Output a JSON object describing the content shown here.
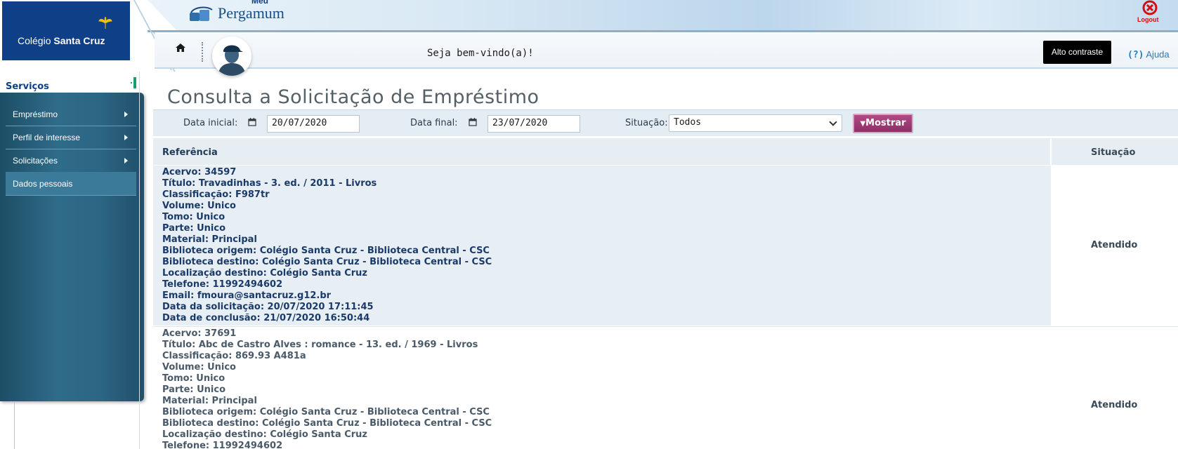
{
  "header": {
    "school_name_light": "Colégio ",
    "school_name_bold": "Santa Cruz",
    "brand_top": "Meu",
    "brand_name": "Pergamum",
    "logout_label": "Logout",
    "welcome": "Seja bem-vindo(a)!",
    "contrast_label": "Alto contraste",
    "help_prefix": "(?)",
    "help_label": " Ajuda"
  },
  "sidebar": {
    "title": "Serviços",
    "items": [
      {
        "label": "Empréstimo",
        "has_submenu": true
      },
      {
        "label": "Perfil de interesse",
        "has_submenu": true
      },
      {
        "label": "Solicitações",
        "has_submenu": true
      },
      {
        "label": "Dados pessoais",
        "has_submenu": false
      }
    ]
  },
  "main": {
    "title": "Consulta a Solicitação de Empréstimo",
    "filters": {
      "start_label": "Data inicial:",
      "start_value": "20/07/2020",
      "end_label": "Data final:",
      "end_value": "23/07/2020",
      "status_label": "Situação:",
      "status_value": "Todos",
      "submit_label": "Mostrar"
    },
    "table": {
      "col_reference": "Referência",
      "col_status": "Situação",
      "rows": [
        {
          "lines": [
            "Acervo: 34597",
            "Título: Travadinhas - 3. ed. / 2011 - Livros",
            "Classificação: F987tr",
            "Volume: Unico",
            "Tomo: Unico",
            "Parte: Unico",
            "Material: Principal",
            "Biblioteca origem: Colégio Santa Cruz - Biblioteca Central - CSC",
            "Biblioteca destino: Colégio Santa Cruz - Biblioteca Central - CSC",
            "Localização destino: Colégio Santa Cruz",
            "Telefone: 11992494602",
            "Email: fmoura@santacruz.g12.br",
            "Data da solicitação: 20/07/2020 17:11:45",
            "Data de conclusão: 21/07/2020 16:50:44"
          ],
          "status": "Atendido"
        },
        {
          "lines": [
            "Acervo: 37691",
            "Título: Abc de Castro Alves : romance - 13. ed. / 1969 - Livros",
            "Classificação: 869.93 A481a",
            "Volume: Unico",
            "Tomo: Unico",
            "Parte: Unico",
            "Material: Principal",
            "Biblioteca origem: Colégio Santa Cruz - Biblioteca Central - CSC",
            "Biblioteca destino: Colégio Santa Cruz - Biblioteca Central - CSC",
            "Localização destino: Colégio Santa Cruz",
            "Telefone: 11992494602"
          ],
          "status": "Atendido"
        }
      ]
    }
  },
  "colors": {
    "brand_blue": "#0e3f87",
    "sidebar_teal": "#2f6c89",
    "submit_magenta": "#a03c78",
    "logout_red": "#d01010"
  }
}
